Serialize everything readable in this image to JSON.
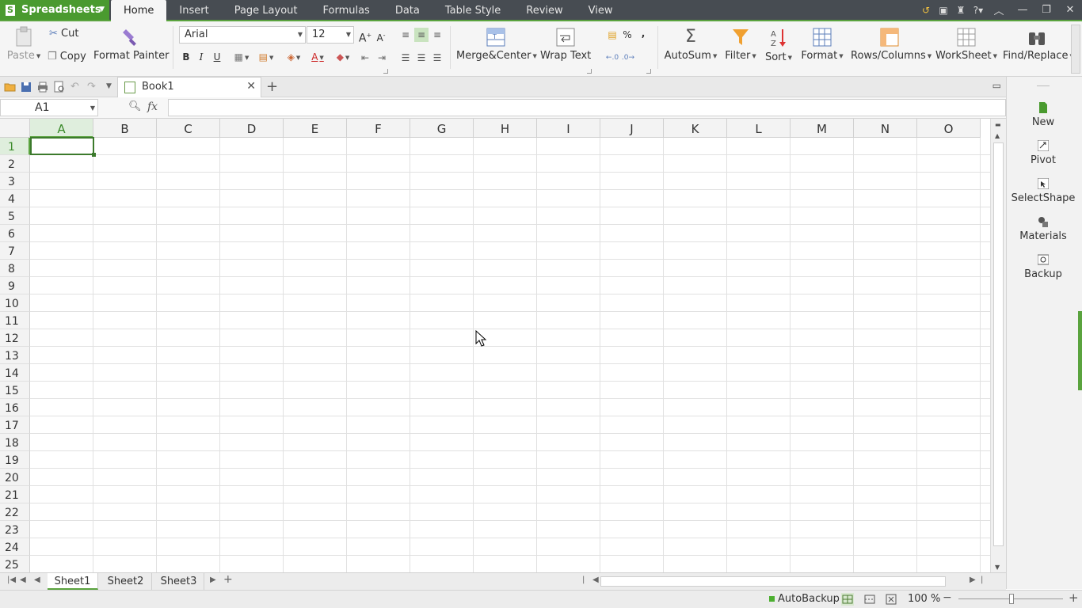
{
  "app": {
    "name": "Spreadsheets",
    "logo": "S"
  },
  "menu": [
    "Home",
    "Insert",
    "Page Layout",
    "Formulas",
    "Data",
    "Table Style",
    "Review",
    "View"
  ],
  "ribbon": {
    "paste": "Paste",
    "cut": "Cut",
    "copy": "Copy",
    "format_painter": "Format Painter",
    "font_name": "Arial",
    "font_size": "12",
    "bold": "B",
    "italic": "I",
    "underline": "U",
    "merge_center": "Merge&Center",
    "wrap_text": "Wrap Text",
    "percent": "%",
    "comma": ",",
    "autosum": "AutoSum",
    "filter": "Filter",
    "sort": "Sort",
    "format": "Format",
    "rows_columns": "Rows/Columns",
    "worksheet": "WorkSheet",
    "find_replace": "Find/Replace"
  },
  "tab": {
    "name": "Book1"
  },
  "formula_bar": {
    "cell_ref": "A1",
    "fx": "fx",
    "value": ""
  },
  "columns": [
    "A",
    "B",
    "C",
    "D",
    "E",
    "F",
    "G",
    "H",
    "I",
    "J",
    "K",
    "L",
    "M",
    "N",
    "O"
  ],
  "rows": [
    "1",
    "2",
    "3",
    "4",
    "5",
    "6",
    "7",
    "8",
    "9",
    "10",
    "11",
    "12",
    "13",
    "14",
    "15",
    "16",
    "17",
    "18",
    "19",
    "20",
    "21",
    "22",
    "23",
    "24",
    "25"
  ],
  "task_pane": [
    "New",
    "Pivot",
    "SelectShape",
    "Materials",
    "Backup"
  ],
  "sheets": [
    "Sheet1",
    "Sheet2",
    "Sheet3"
  ],
  "status": {
    "autobackup": "AutoBackup",
    "zoom": "100 %"
  },
  "colors": {
    "accent": "#5aa33e",
    "titlebar": "#474c52"
  }
}
